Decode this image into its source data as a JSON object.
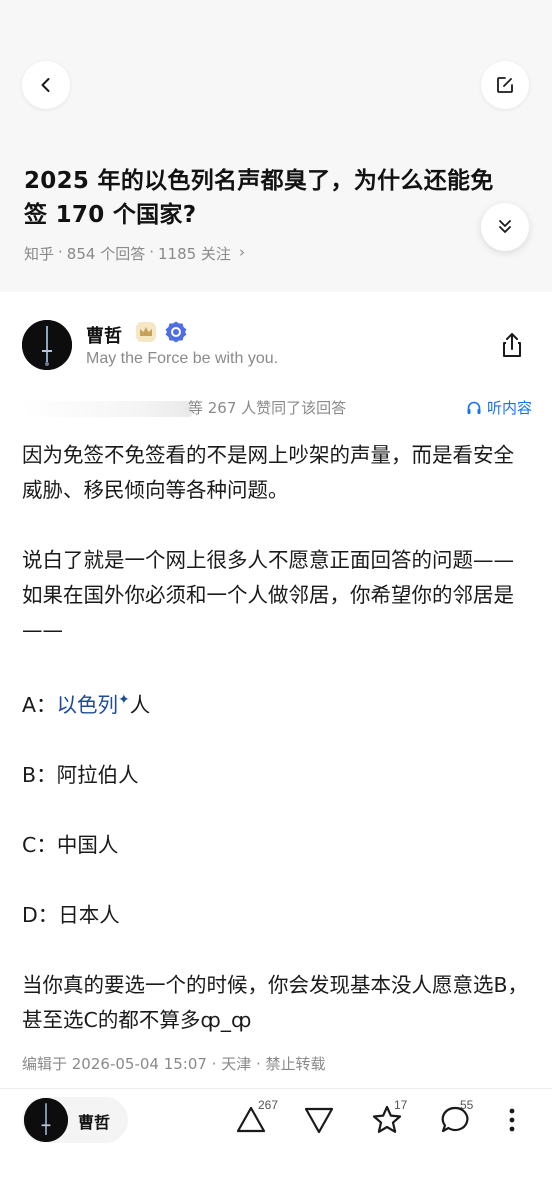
{
  "header": {
    "back_icon": "chevron-left-icon",
    "edit_icon": "edit-icon",
    "expand_icon": "chevrons-down-icon"
  },
  "question": {
    "title": "2025 年的以色列名声都臭了，为什么还能免签 170 个国家?",
    "source": "知乎",
    "answer_count": "854 个回答",
    "follow_count": "1185 关注",
    "sep": "·",
    "more": "›"
  },
  "author": {
    "name": "曹哲",
    "bio": "May the Force be with you.",
    "badges": [
      "crown-badge-icon",
      "verified-badge-icon"
    ]
  },
  "answer": {
    "likes_text": "等 267 人赞同了该回答",
    "listen_label": "听内容",
    "paragraphs": {
      "p1": "因为免签不免签看的不是网上吵架的声量，而是看安全威胁、移民倾向等各种问题。",
      "p2": "说白了就是一个网上很多人不愿意正面回答的问题——如果在国外你必须和一个人做邻居，你希望你的邻居是——",
      "a_prefix": "A：",
      "a_link": "以色列",
      "a_spark": "✦",
      "a_suffix": "人",
      "b": "B：阿拉伯人",
      "c": "C：中国人",
      "d": "D：日本人",
      "p3": "当你真的要选一个的时候，你会发现基本没人愿意选B，甚至选C的都不算多ȹ_ȹ"
    },
    "edit_meta": "编辑于 2026-05-04 15:07 · 天津 · 禁止转载"
  },
  "bottom_bar": {
    "author_name": "曹哲",
    "upvote_count": "267",
    "favorite_count": "17",
    "comment_count": "55",
    "icons": [
      "upvote-icon",
      "downvote-icon",
      "star-icon",
      "comment-icon",
      "more-icon"
    ]
  }
}
